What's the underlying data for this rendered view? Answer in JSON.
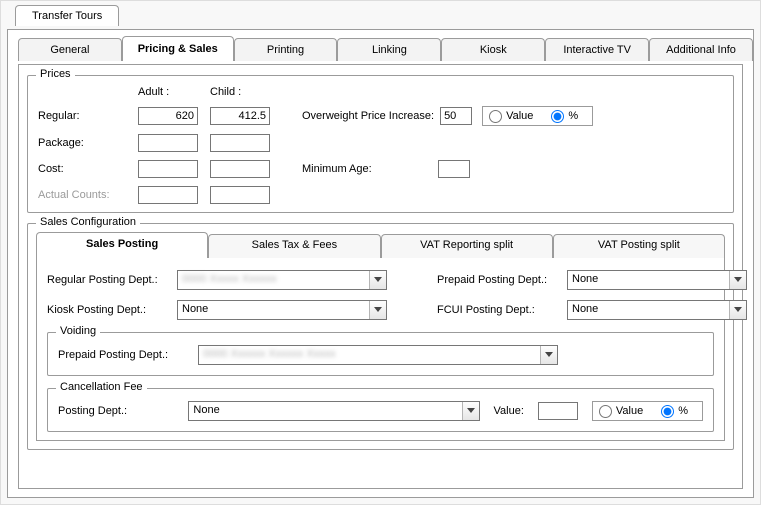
{
  "outer_tab": "Transfer Tours",
  "inner_tabs": {
    "general": "General",
    "pricing": "Pricing & Sales",
    "printing": "Printing",
    "linking": "Linking",
    "kiosk": "Kiosk",
    "itv": "Interactive TV",
    "addl": "Additional Info"
  },
  "prices": {
    "legend": "Prices",
    "hdr_adult": "Adult :",
    "hdr_child": "Child :",
    "lbl_regular": "Regular:",
    "lbl_package": "Package:",
    "lbl_cost": "Cost:",
    "lbl_actual": "Actual Counts:",
    "regular_adult": "620",
    "regular_child": "412.5",
    "package_adult": "",
    "package_child": "",
    "cost_adult": "",
    "cost_child": "",
    "actual_adult": "",
    "actual_child": "",
    "lbl_overweight": "Overweight Price Increase:",
    "overweight_value": "50",
    "radio_value": "Value",
    "radio_percent": "%",
    "lbl_min_age": "Minimum Age:",
    "min_age_value": ""
  },
  "sales": {
    "legend": "Sales Configuration",
    "tabs": {
      "posting": "Sales Posting",
      "taxfees": "Sales Tax & Fees",
      "vat_rep": "VAT Reporting split",
      "vat_post": "VAT Posting split"
    },
    "lbl_regular_dept": "Regular Posting Dept.:",
    "lbl_kiosk_dept": "Kiosk Posting Dept.:",
    "lbl_prepaid_dept": "Prepaid Posting Dept.:",
    "lbl_fcui_dept": "FCUI Posting Dept.:",
    "regular_dept_value": "0000  Xxxxx Xxxxxx",
    "kiosk_dept_value": "None",
    "prepaid_dept_value": "None",
    "fcui_dept_value": "None",
    "voiding": {
      "legend": "Voiding",
      "lbl_prepaid_dept": "Prepaid Posting Dept.:",
      "prepaid_dept_value": "0000  Xxxxxx Xxxxxx Xxxxx"
    },
    "cancel": {
      "legend": "Cancellation Fee",
      "lbl_dept": "Posting Dept.:",
      "dept_value": "None",
      "lbl_value": "Value:",
      "value": "",
      "radio_value": "Value",
      "radio_percent": "%"
    }
  }
}
